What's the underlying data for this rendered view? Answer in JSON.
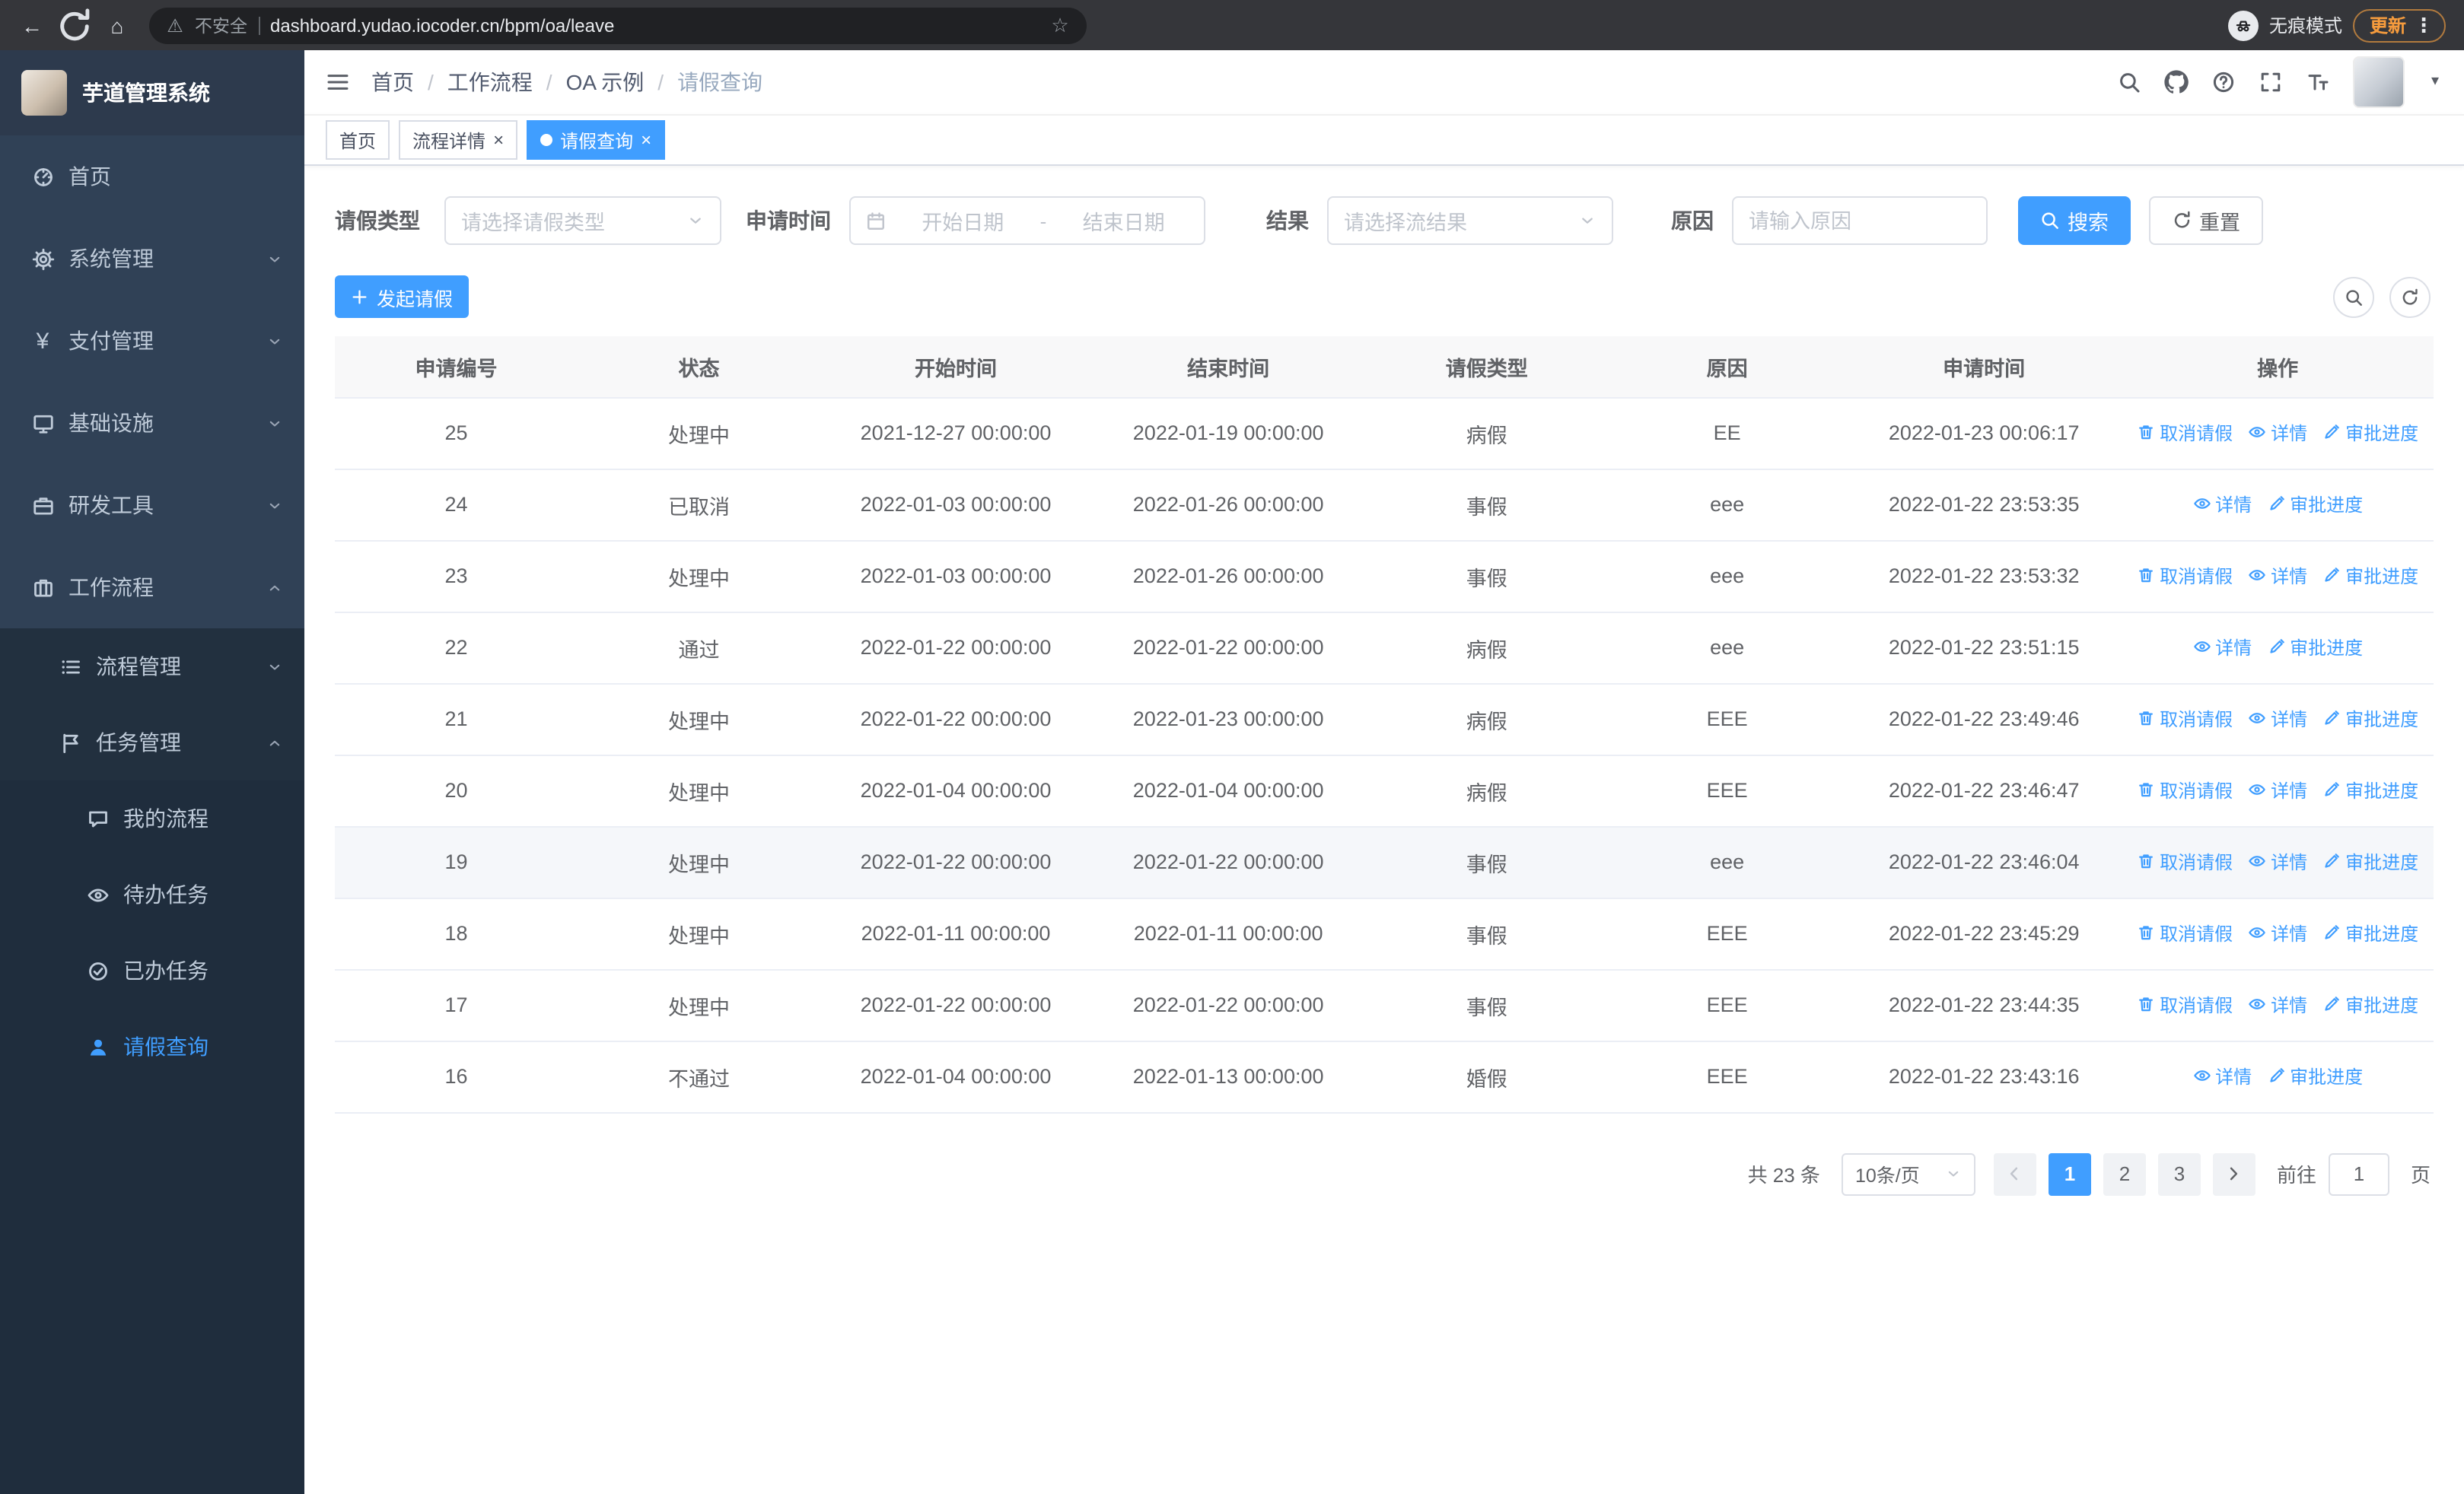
{
  "browser": {
    "security_warning": "不安全",
    "url": "dashboard.yudao.iocoder.cn/bpm/oa/leave",
    "incognito_label": "无痕模式",
    "update_label": "更新"
  },
  "sidebar": {
    "app_title": "芋道管理系统",
    "items": [
      {
        "label": "首页",
        "icon": "dashboard-icon",
        "level": 1
      },
      {
        "label": "系统管理",
        "icon": "gear-icon",
        "level": 1,
        "chevron": "down"
      },
      {
        "label": "支付管理",
        "icon": "yen-icon",
        "level": 1,
        "chevron": "down"
      },
      {
        "label": "基础设施",
        "icon": "monitor-icon",
        "level": 1,
        "chevron": "down"
      },
      {
        "label": "研发工具",
        "icon": "briefcase-icon",
        "level": 1,
        "chevron": "down"
      },
      {
        "label": "工作流程",
        "icon": "suitcase-icon",
        "level": 1,
        "chevron": "up"
      },
      {
        "label": "流程管理",
        "icon": "list-icon",
        "level": 2,
        "chevron": "down"
      },
      {
        "label": "任务管理",
        "icon": "flag-icon",
        "level": 2,
        "chevron": "up"
      },
      {
        "label": "我的流程",
        "icon": "chat-icon",
        "level": 3
      },
      {
        "label": "待办任务",
        "icon": "eye-icon",
        "level": 3
      },
      {
        "label": "已办任务",
        "icon": "check-circle-icon",
        "level": 3
      },
      {
        "label": "请假查询",
        "icon": "user-icon",
        "level": 3,
        "active": true
      }
    ]
  },
  "header": {
    "breadcrumb": [
      "首页",
      "工作流程",
      "OA 示例",
      "请假查询"
    ]
  },
  "tabs": [
    {
      "label": "首页",
      "closable": false,
      "active": false
    },
    {
      "label": "流程详情",
      "closable": true,
      "active": false
    },
    {
      "label": "请假查询",
      "closable": true,
      "active": true
    }
  ],
  "filters": {
    "leave_type_label": "请假类型",
    "leave_type_placeholder": "请选择请假类型",
    "apply_time_label": "申请时间",
    "start_date_placeholder": "开始日期",
    "range_separator": "-",
    "end_date_placeholder": "结束日期",
    "result_label": "结果",
    "result_placeholder": "请选择流结果",
    "reason_label": "原因",
    "reason_placeholder": "请输入原因",
    "search_label": "搜索",
    "reset_label": "重置"
  },
  "toolbar": {
    "create_label": "发起请假"
  },
  "table": {
    "columns": [
      "申请编号",
      "状态",
      "开始时间",
      "结束时间",
      "请假类型",
      "原因",
      "申请时间",
      "操作"
    ],
    "action_labels": {
      "cancel": "取消请假",
      "detail": "详情",
      "progress": "审批进度"
    },
    "rows": [
      {
        "id": "25",
        "status": "处理中",
        "start": "2021-12-27 00:00:00",
        "end": "2022-01-19 00:00:00",
        "type": "病假",
        "reason": "EE",
        "apply_time": "2022-01-23 00:06:17",
        "actions": [
          "cancel",
          "detail",
          "progress"
        ]
      },
      {
        "id": "24",
        "status": "已取消",
        "start": "2022-01-03 00:00:00",
        "end": "2022-01-26 00:00:00",
        "type": "事假",
        "reason": "eee",
        "apply_time": "2022-01-22 23:53:35",
        "actions": [
          "detail",
          "progress"
        ]
      },
      {
        "id": "23",
        "status": "处理中",
        "start": "2022-01-03 00:00:00",
        "end": "2022-01-26 00:00:00",
        "type": "事假",
        "reason": "eee",
        "apply_time": "2022-01-22 23:53:32",
        "actions": [
          "cancel",
          "detail",
          "progress"
        ]
      },
      {
        "id": "22",
        "status": "通过",
        "start": "2022-01-22 00:00:00",
        "end": "2022-01-22 00:00:00",
        "type": "病假",
        "reason": "eee",
        "apply_time": "2022-01-22 23:51:15",
        "actions": [
          "detail",
          "progress"
        ]
      },
      {
        "id": "21",
        "status": "处理中",
        "start": "2022-01-22 00:00:00",
        "end": "2022-01-23 00:00:00",
        "type": "病假",
        "reason": "EEE",
        "apply_time": "2022-01-22 23:49:46",
        "actions": [
          "cancel",
          "detail",
          "progress"
        ]
      },
      {
        "id": "20",
        "status": "处理中",
        "start": "2022-01-04 00:00:00",
        "end": "2022-01-04 00:00:00",
        "type": "病假",
        "reason": "EEE",
        "apply_time": "2022-01-22 23:46:47",
        "actions": [
          "cancel",
          "detail",
          "progress"
        ]
      },
      {
        "id": "19",
        "status": "处理中",
        "start": "2022-01-22 00:00:00",
        "end": "2022-01-22 00:00:00",
        "type": "事假",
        "reason": "eee",
        "apply_time": "2022-01-22 23:46:04",
        "actions": [
          "cancel",
          "detail",
          "progress"
        ],
        "highlighted": true
      },
      {
        "id": "18",
        "status": "处理中",
        "start": "2022-01-11 00:00:00",
        "end": "2022-01-11 00:00:00",
        "type": "事假",
        "reason": "EEE",
        "apply_time": "2022-01-22 23:45:29",
        "actions": [
          "cancel",
          "detail",
          "progress"
        ]
      },
      {
        "id": "17",
        "status": "处理中",
        "start": "2022-01-22 00:00:00",
        "end": "2022-01-22 00:00:00",
        "type": "事假",
        "reason": "EEE",
        "apply_time": "2022-01-22 23:44:35",
        "actions": [
          "cancel",
          "detail",
          "progress"
        ]
      },
      {
        "id": "16",
        "status": "不通过",
        "start": "2022-01-04 00:00:00",
        "end": "2022-01-13 00:00:00",
        "type": "婚假",
        "reason": "EEE",
        "apply_time": "2022-01-22 23:43:16",
        "actions": [
          "detail",
          "progress"
        ]
      }
    ]
  },
  "pagination": {
    "total_text": "共 23 条",
    "page_size": "10条/页",
    "pages": [
      "1",
      "2",
      "3"
    ],
    "active_page": "1",
    "goto_label": "前往",
    "goto_value": "1",
    "page_suffix": "页"
  }
}
